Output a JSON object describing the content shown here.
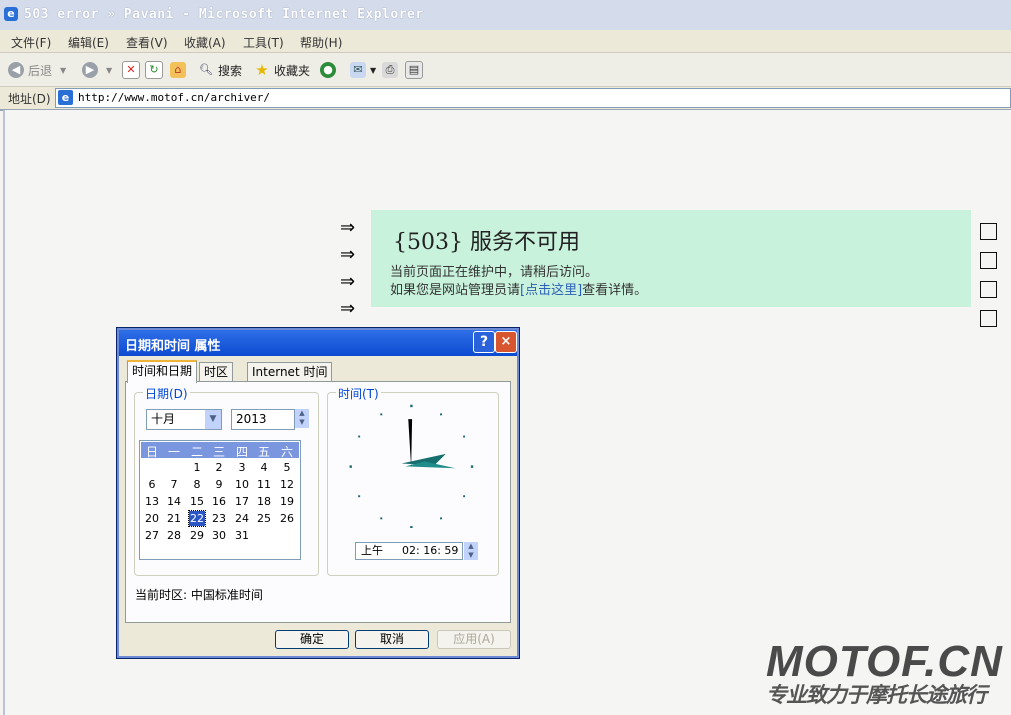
{
  "window": {
    "title": "503 error » Pavani - Microsoft Internet Explorer"
  },
  "menu": [
    "文件(F)",
    "编辑(E)",
    "查看(V)",
    "收藏(A)",
    "工具(T)",
    "帮助(H)"
  ],
  "toolbar": {
    "back": "后退",
    "search": "搜索",
    "favorites": "收藏夹"
  },
  "address": {
    "label": "地址(D)",
    "url": "http://www.motof.cn/archiver/"
  },
  "page": {
    "arrows": [
      "⇒",
      "⇒",
      "⇒",
      "⇒"
    ],
    "heading": "{503} 服务不可用",
    "line1": "当前页面正在维护中，请稍后访问。",
    "line2_pre": "如果您是网站管理员请",
    "line2_link": "[点击这里]",
    "line2_post": "查看详情。"
  },
  "dialog": {
    "title": "日期和时间 属性",
    "help": "?",
    "close": "×",
    "tabs": [
      "时间和日期",
      "时区",
      "Internet 时间"
    ],
    "date_group": "日期(D)",
    "month": "十月",
    "year": "2013",
    "weekdays": [
      "日",
      "一",
      "二",
      "三",
      "四",
      "五",
      "六"
    ],
    "days": [
      [
        "",
        "",
        "1",
        "2",
        "3",
        "4",
        "5"
      ],
      [
        "6",
        "7",
        "8",
        "9",
        "10",
        "11",
        "12"
      ],
      [
        "13",
        "14",
        "15",
        "16",
        "17",
        "18",
        "19"
      ],
      [
        "20",
        "21",
        "22",
        "23",
        "24",
        "25",
        "26"
      ],
      [
        "27",
        "28",
        "29",
        "30",
        "31",
        "",
        ""
      ]
    ],
    "selected_day": "22",
    "time_group": "时间(T)",
    "ampm": "上午",
    "time": "02: 16: 59",
    "timezone": "当前时区: 中国标准时间",
    "ok": "确定",
    "cancel": "取消",
    "apply": "应用(A)"
  },
  "watermark": {
    "big": "MOTOF.CN",
    "small": "专业致力于摩托长途旅行"
  },
  "colors": {
    "notice_bg": "#c9f2dc",
    "dialog_title": "#0c4ad1",
    "link": "#2c5fb7"
  }
}
